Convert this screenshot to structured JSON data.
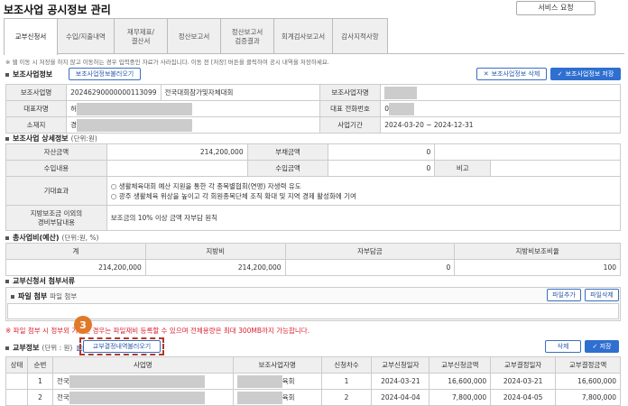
{
  "header": {
    "title": "보조사업 공시정보 관리",
    "service_request": "서비스 요청"
  },
  "tabs": [
    "교부신청서",
    "수입/지출내역",
    "재무제표/\n결산서",
    "정산보고서",
    "정산보고서\n검증결과",
    "회계검사보고서",
    "감사지적사항"
  ],
  "notice": "※ 웹 이동 시 저장을 하지 않고 이동하는 경우 입력중인 자료가 사라집니다. 이동 전 [저장] 버튼을 클릭하여 공시 내역을 저장하세요.",
  "info": {
    "section": "보조사업정보",
    "load_btn": "보조사업정보불러오기",
    "delete_btn": "보조사업정보 삭제",
    "save_btn": "보조사업정보 저장",
    "labels": [
      "보조사업명",
      "보조사업자명",
      "대표자명",
      "대표 전화번호",
      "소재지",
      "사업기간"
    ],
    "project_code": "20246290000000113099",
    "project_name": "전국대회참가및자체대회",
    "rep_prefix": "허",
    "phone_prefix": "0",
    "addr_prefix": "경",
    "period": "2024-03-20 ~ 2024-12-31"
  },
  "detail": {
    "section": "보조사업 상세정보",
    "unit": "(단위:원)",
    "labels": [
      "자산금액",
      "부채금액",
      "수입내용",
      "수입금액",
      "비고",
      "기대효과",
      "지방보조금 이외의\n경비부담내용"
    ],
    "asset": "214,200,000",
    "debt": "0",
    "income_amt": "0",
    "effect1": "○ 생활체육대회 예산 지원을 통한 각 종목별협회(연맹) 자생력 유도",
    "effect2": "○ 광주 생활체육 위상을 높이고 각 회원종목단체 조직 확대 및 지역 경제 활성화에 기여",
    "burden": "보조금의 10% 이상 금액 자부담 원칙"
  },
  "budget": {
    "section": "총사업비(예산)",
    "unit": "(단위:원, %)",
    "headers": [
      "계",
      "지방비",
      "자부담금",
      "지방비보조비율"
    ],
    "values": [
      "214,200,000",
      "214,200,000",
      "0",
      "100"
    ]
  },
  "attach": {
    "section": "교부신청서 첨부서류",
    "file_label": "파일 첨부",
    "file_sub": "파일 첨부",
    "add_btn": "파일추가",
    "del_btn": "파일삭제",
    "alert": "※ 파일 첨부 시 정부외 기관인 경우는 파일재비 등록할 수 있으며 전체용량은 최대 300MB까지 가능합니다."
  },
  "grant": {
    "section": "교부정보",
    "unit": "(단위 : 원)",
    "load_btn": "교부결정내역불러오기",
    "delete_btn": "삭제",
    "save_btn": "✓ 저장",
    "step": "3",
    "headers": [
      "상태",
      "순번",
      "사업명",
      "보조사업자명",
      "신청차수",
      "교부신청일자",
      "교부신청금액",
      "교부결정일자",
      "교부결정금액"
    ],
    "rows": [
      {
        "seq": "1",
        "name_prefix": "전국",
        "org_suffix": "육회",
        "round": "1",
        "req_date": "2024-03-21",
        "req_amt": "16,600,000",
        "dec_date": "2024-03-21",
        "dec_amt": "16,600,000"
      },
      {
        "seq": "2",
        "name_prefix": "전국",
        "org_suffix": "육회",
        "round": "2",
        "req_date": "2024-04-04",
        "req_amt": "7,800,000",
        "dec_date": "2024-04-05",
        "dec_amt": "7,800,000"
      }
    ]
  }
}
